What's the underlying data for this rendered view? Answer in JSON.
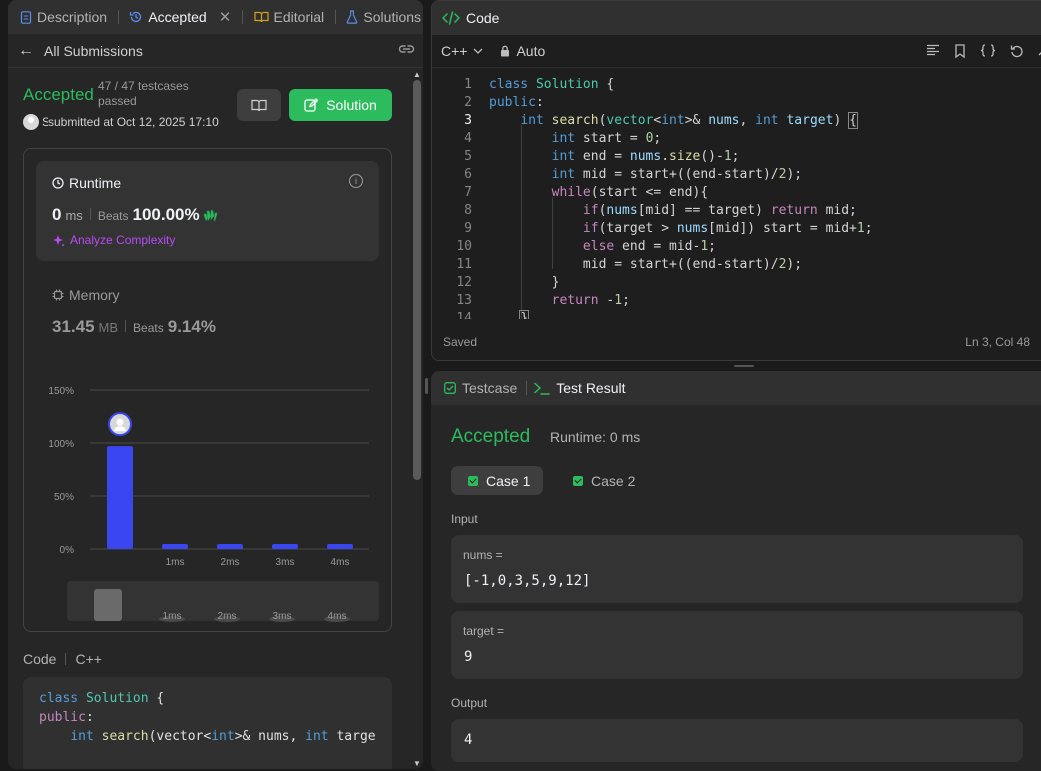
{
  "left_tabs": [
    {
      "label": "Description",
      "icon": "document-icon"
    },
    {
      "label": "Accepted",
      "icon": "history-icon"
    },
    {
      "label": "Editorial",
      "icon": "book-icon"
    },
    {
      "label": "Solutions",
      "icon": "flask-icon"
    }
  ],
  "submissions_bar": {
    "label": "All Submissions"
  },
  "submission": {
    "status": "Accepted",
    "testcases": "47 / 47 testcases passed",
    "user_initial": "S",
    "submitted": "submitted at Oct 12, 2025 17:10",
    "solution_button": "Solution"
  },
  "runtime": {
    "title": "Runtime",
    "value": "0",
    "unit": "ms",
    "beats_label": "Beats",
    "beats_value": "100.00%",
    "analyze": "Analyze Complexity"
  },
  "memory": {
    "title": "Memory",
    "value": "31.45",
    "unit": "MB",
    "beats_label": "Beats",
    "beats_value": "9.14%"
  },
  "chart_data": {
    "type": "bar",
    "y_ticks": [
      "150%",
      "100%",
      "50%",
      "0%"
    ],
    "ylim": [
      0,
      150
    ],
    "categories": [
      "",
      "1ms",
      "2ms",
      "3ms",
      "4ms"
    ],
    "values": [
      97,
      1,
      1,
      1,
      1
    ],
    "highlight_index": 0,
    "overview_labels": [
      "1ms",
      "2ms",
      "3ms",
      "4ms"
    ],
    "bar_color": "#3a46f0"
  },
  "code_section": {
    "label": "Code",
    "language": "C++",
    "lines": [
      "class Solution {",
      "public:",
      "    int search(vector<int>& nums, int targe"
    ]
  },
  "editor": {
    "title": "Code",
    "language": "C++",
    "mode": "Auto",
    "status": "Saved",
    "position": "Ln 3, Col 48",
    "line_numbers": [
      "1",
      "2",
      "3",
      "4",
      "5",
      "6",
      "7",
      "8",
      "9",
      "10",
      "11",
      "12",
      "13",
      "14"
    ],
    "current_line": 3
  },
  "result": {
    "tabs": [
      "Testcase",
      "Test Result"
    ],
    "status": "Accepted",
    "runtime": "Runtime: 0 ms",
    "cases": [
      "Case 1",
      "Case 2"
    ],
    "input_label": "Input",
    "inputs": [
      {
        "name": "nums =",
        "value": "[-1,0,3,5,9,12]"
      },
      {
        "name": "target =",
        "value": "9"
      }
    ],
    "output_label": "Output",
    "output": "4"
  },
  "colors": {
    "accent_green": "#2cbb5d",
    "purple": "#b84cf5",
    "bar_blue": "#3a46f0"
  }
}
